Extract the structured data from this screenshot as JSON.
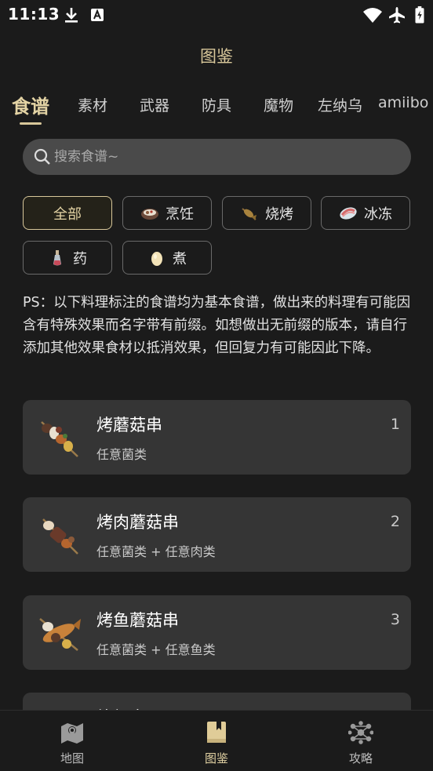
{
  "status_bar": {
    "time": "11:13",
    "left_icons": [
      "download-icon",
      "a-box-icon"
    ],
    "right_icons": [
      "wifi-icon",
      "airplane-icon",
      "battery-icon"
    ]
  },
  "header": {
    "title": "图鉴"
  },
  "tabs": [
    {
      "label": "食谱",
      "active": true
    },
    {
      "label": "素材"
    },
    {
      "label": "武器"
    },
    {
      "label": "防具"
    },
    {
      "label": "魔物"
    },
    {
      "label": "左纳乌"
    },
    {
      "label": "amiibo"
    }
  ],
  "search": {
    "placeholder": "搜索食谱~",
    "value": ""
  },
  "filters": [
    {
      "label": "全部",
      "active": true,
      "icon": ""
    },
    {
      "label": "烹饪",
      "icon": "pot-icon"
    },
    {
      "label": "烧烤",
      "icon": "roast-icon"
    },
    {
      "label": "冰冻",
      "icon": "frozen-meat-icon"
    },
    {
      "label": "药",
      "icon": "elixir-bottle-icon"
    },
    {
      "label": "煮",
      "icon": "boiled-egg-icon"
    }
  ],
  "note": "PS：以下料理标注的食谱均为基本食谱，做出来的料理有可能因含有特殊效果而名字带有前缀。如想做出无前缀的版本，请自行添加其他效果食材以抵消效果，但回复力有可能因此下降。",
  "recipes": [
    {
      "name": "烤蘑菇串",
      "ingredients": "任意菌类",
      "num": "1",
      "icon": "mushroom-skewer-icon"
    },
    {
      "name": "烤肉蘑菇串",
      "ingredients": "任意菌类 + 任意肉类",
      "num": "2",
      "icon": "meat-mushroom-skewer-icon"
    },
    {
      "name": "烤鱼蘑菇串",
      "ingredients": "任意菌类 + 任意鱼类",
      "num": "3",
      "icon": "fish-mushroom-skewer-icon"
    },
    {
      "name": "烤虾串",
      "ingredients": "",
      "num": "",
      "icon": ""
    }
  ],
  "bottom_nav": [
    {
      "label": "地图",
      "icon": "map-icon"
    },
    {
      "label": "图鉴",
      "icon": "book-icon",
      "active": true
    },
    {
      "label": "攻略",
      "icon": "network-icon"
    }
  ],
  "colors": {
    "background": "#1b1b1b",
    "accent": "#d8c79a",
    "card": "#353535",
    "search_bg": "#4a4a4a"
  }
}
